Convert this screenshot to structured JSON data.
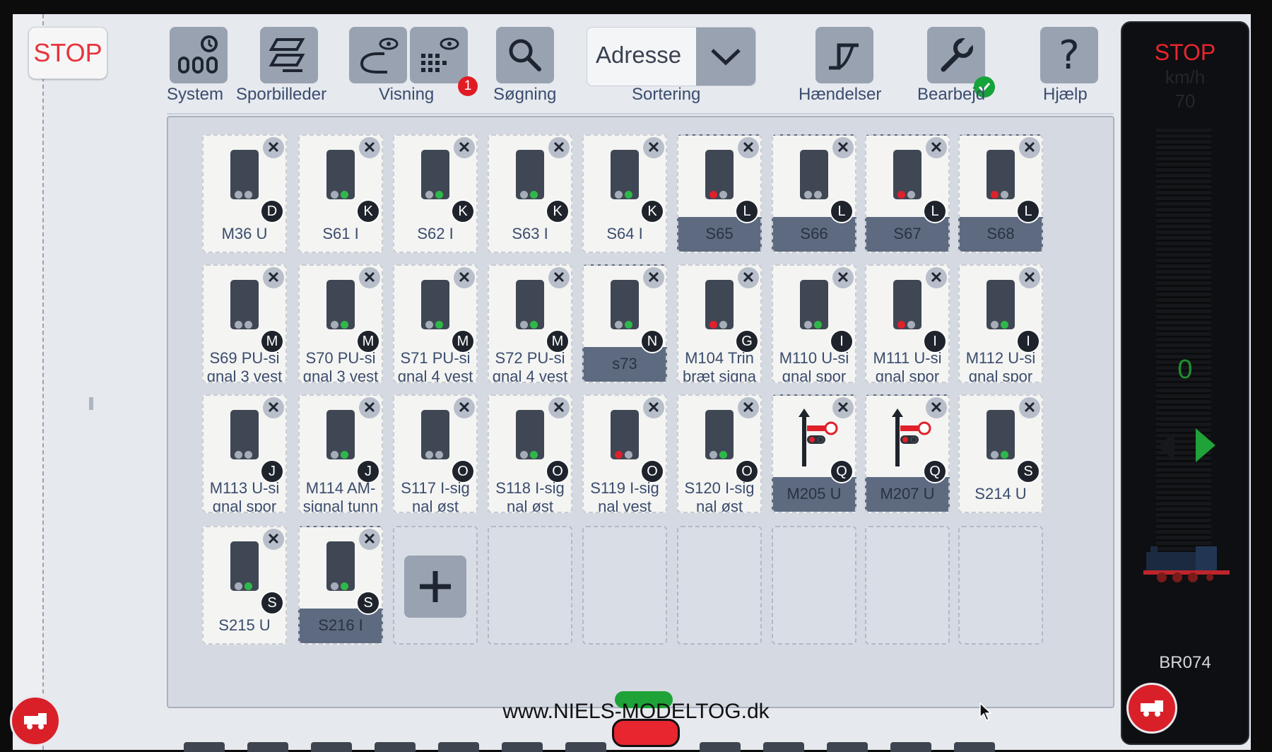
{
  "toolbar": {
    "stop_label": "STOP",
    "system_label": "System",
    "sporbilleder_label": "Sporbilleder",
    "visning_label": "Visning",
    "visning_badge": "1",
    "sogning_label": "Søgning",
    "sort_value": "Adresse",
    "sortering_label": "Sortering",
    "haendelser_label": "Hændelser",
    "bearbejd_label": "Bearbejd",
    "hjaelp_label": "Hjælp"
  },
  "tiles": [
    {
      "label": "M36 U",
      "letter": "D",
      "active": false,
      "lamps": [
        "g",
        "g"
      ]
    },
    {
      "label": "S61 I",
      "letter": "K",
      "active": false,
      "lamps": [
        "g",
        "G"
      ]
    },
    {
      "label": "S62 I",
      "letter": "K",
      "active": false,
      "lamps": [
        "g",
        "G"
      ]
    },
    {
      "label": "S63 I",
      "letter": "K",
      "active": false,
      "lamps": [
        "g",
        "G"
      ]
    },
    {
      "label": "S64 I",
      "letter": "K",
      "active": false,
      "lamps": [
        "g",
        "G"
      ]
    },
    {
      "label": "S65",
      "letter": "L",
      "active": true,
      "lamps": [
        "R",
        "g"
      ]
    },
    {
      "label": "S66",
      "letter": "L",
      "active": true,
      "lamps": [
        "g",
        "g"
      ]
    },
    {
      "label": "S67",
      "letter": "L",
      "active": true,
      "lamps": [
        "R",
        "g"
      ]
    },
    {
      "label": "S68",
      "letter": "L",
      "active": true,
      "lamps": [
        "R",
        "g"
      ]
    },
    {
      "label": "S69 PU-si\ngnal 3 vest",
      "letter": "M",
      "active": false,
      "lamps": [
        "g",
        "g"
      ]
    },
    {
      "label": "S70 PU-si\ngnal 3 vest",
      "letter": "M",
      "active": false,
      "lamps": [
        "g",
        "G"
      ]
    },
    {
      "label": "S71 PU-si\ngnal 4 vest",
      "letter": "M",
      "active": false,
      "lamps": [
        "g",
        "G"
      ]
    },
    {
      "label": "S72 PU-si\ngnal 4 vest",
      "letter": "M",
      "active": false,
      "lamps": [
        "g",
        "G"
      ]
    },
    {
      "label": "s73",
      "letter": "N",
      "active": true,
      "lamps": [
        "g",
        "G"
      ]
    },
    {
      "label": "M104 Trin\nbræt signa",
      "letter": "G",
      "active": false,
      "lamps": [
        "R",
        "g"
      ]
    },
    {
      "label": "M110 U-si\ngnal spor",
      "letter": "I",
      "active": false,
      "lamps": [
        "g",
        "G"
      ]
    },
    {
      "label": "M111 U-si\ngnal spor",
      "letter": "I",
      "active": false,
      "lamps": [
        "R",
        "g"
      ]
    },
    {
      "label": "M112 U-si\ngnal spor",
      "letter": "I",
      "active": false,
      "lamps": [
        "g",
        "G"
      ]
    },
    {
      "label": "M113 U-si\ngnal spor",
      "letter": "J",
      "active": false,
      "lamps": [
        "g",
        "g"
      ]
    },
    {
      "label": "M114 AM-\nsignal tunn",
      "letter": "J",
      "active": false,
      "lamps": [
        "g",
        "G"
      ]
    },
    {
      "label": "S117 I-sig\nnal øst",
      "letter": "O",
      "active": false,
      "lamps": [
        "g",
        "g"
      ]
    },
    {
      "label": "S118 I-sig\nnal øst",
      "letter": "O",
      "active": false,
      "lamps": [
        "g",
        "G"
      ]
    },
    {
      "label": "S119 I-sig\nnal vest",
      "letter": "O",
      "active": false,
      "lamps": [
        "R",
        "g"
      ]
    },
    {
      "label": "S120 I-sig\nnal øst",
      "letter": "O",
      "active": false,
      "lamps": [
        "g",
        "G"
      ]
    },
    {
      "label": "M205 U",
      "letter": "Q",
      "active": true,
      "lamps": [],
      "semaphore": true
    },
    {
      "label": "M207 U",
      "letter": "Q",
      "active": true,
      "lamps": [],
      "semaphore": true
    },
    {
      "label": "S214 U",
      "letter": "S",
      "active": false,
      "lamps": [
        "g",
        "G"
      ]
    },
    {
      "label": "S215 U",
      "letter": "S",
      "active": false,
      "lamps": [
        "g",
        "G"
      ]
    },
    {
      "label": "S216 I",
      "letter": "S",
      "active": true,
      "lamps": [
        "g",
        "G"
      ]
    }
  ],
  "right_panel": {
    "stop_label": "STOP",
    "unit": "km/h",
    "max_speed": "70",
    "speed": "0",
    "loco_name": "BR074"
  },
  "watermark": "www.NIELS-MODELTOG.dk",
  "colors": {
    "stop_red": "#e8333c",
    "toolbar_blue": "#3a4c6e",
    "accent_green": "#1fa237"
  }
}
